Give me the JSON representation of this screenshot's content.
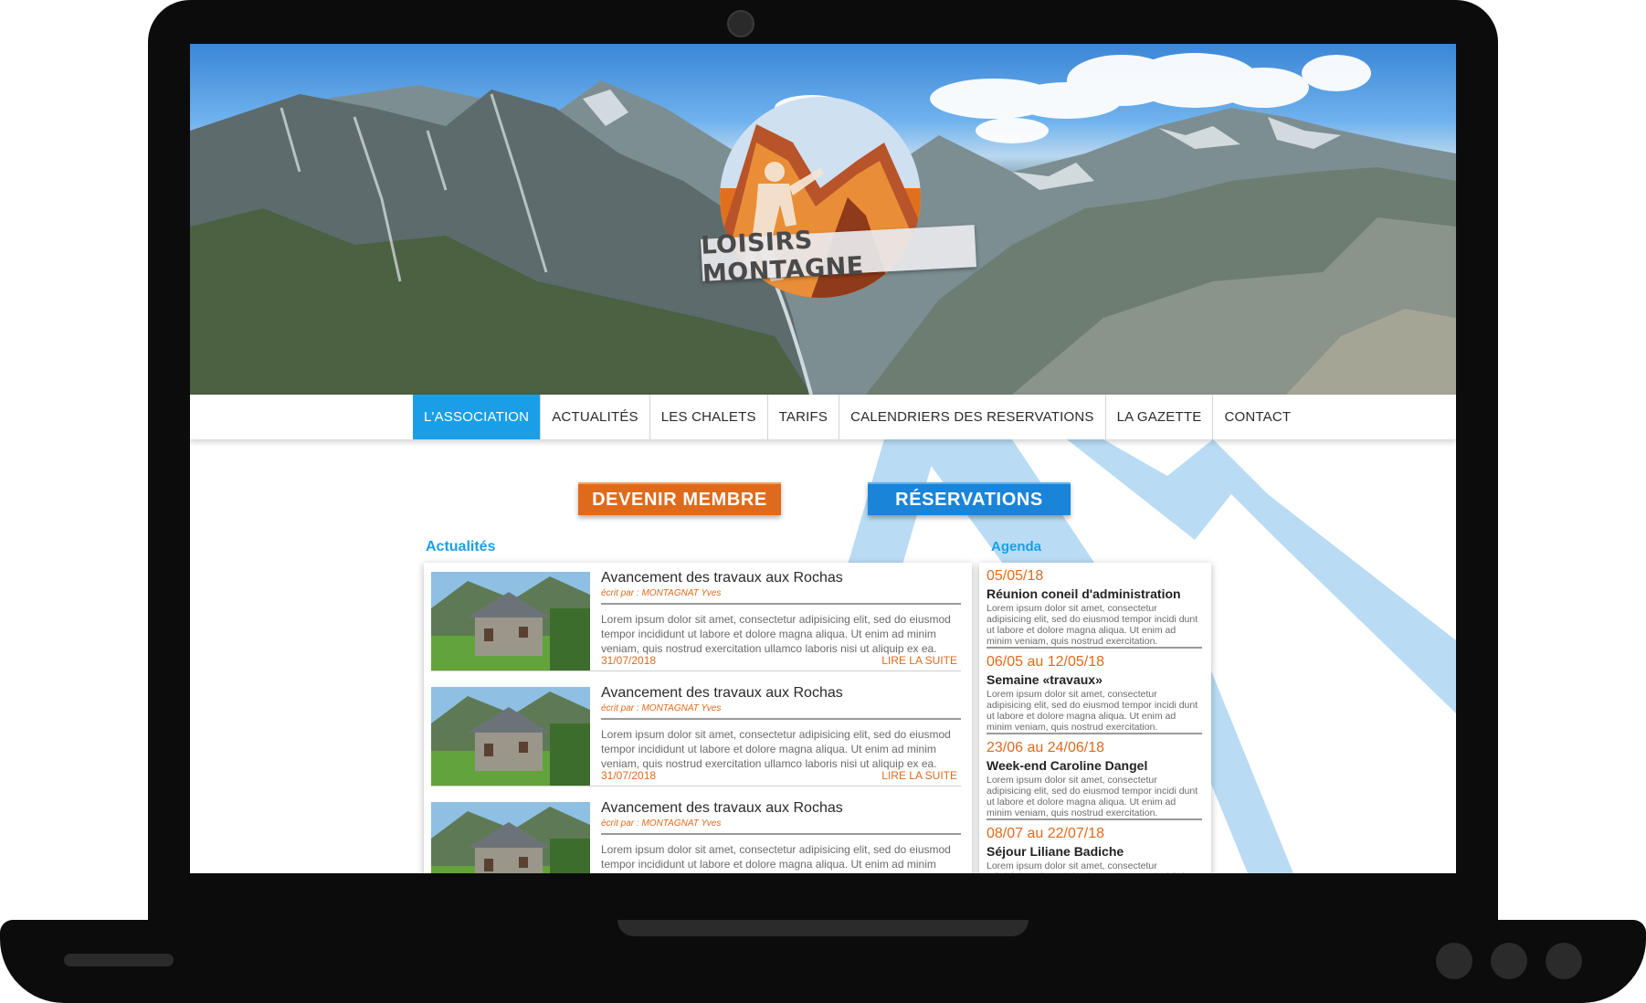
{
  "site": {
    "logo_text": "LOISIRS MONTAGNE",
    "brand_colors": {
      "orange": "#e06a1b",
      "blue": "#1a9fe6"
    }
  },
  "nav": {
    "items": [
      {
        "label": "L'ASSOCIATION",
        "active": true
      },
      {
        "label": "ACTUALITÉS",
        "active": false
      },
      {
        "label": "LES CHALETS",
        "active": false
      },
      {
        "label": "TARIFS",
        "active": false
      },
      {
        "label": "CALENDRIERS DES RESERVATIONS",
        "active": false
      },
      {
        "label": "LA GAZETTE",
        "active": false
      },
      {
        "label": "CONTACT",
        "active": false
      }
    ]
  },
  "cta": {
    "member": "DEVENIR MEMBRE",
    "reservations": "RÉSERVATIONS"
  },
  "news": {
    "title": "Actualités",
    "items": [
      {
        "title": "Avancement des travaux aux Rochas",
        "author": "écrit par : MONTAGNAT Yves",
        "body": "Lorem ipsum dolor sit amet, consectetur adipisicing elit, sed do eiusmod tempor incididunt ut labore et dolore magna aliqua. Ut enim ad minim veniam, quis nostrud exercitation ullamco laboris nisi ut aliquip ex ea.",
        "date": "31/07/2018",
        "more": "LIRE LA SUITE"
      },
      {
        "title": "Avancement des travaux aux Rochas",
        "author": "écrit par : MONTAGNAT Yves",
        "body": "Lorem ipsum dolor sit amet, consectetur adipisicing elit, sed do eiusmod tempor incididunt ut labore et dolore magna aliqua. Ut enim ad minim veniam, quis nostrud exercitation ullamco laboris nisi ut aliquip ex ea.",
        "date": "31/07/2018",
        "more": "LIRE LA SUITE"
      },
      {
        "title": "Avancement des travaux aux Rochas",
        "author": "écrit par : MONTAGNAT Yves",
        "body": "Lorem ipsum dolor sit amet, consectetur adipisicing elit, sed do eiusmod tempor incididunt ut labore et dolore magna aliqua. Ut enim ad minim",
        "date": "",
        "more": ""
      }
    ]
  },
  "agenda": {
    "title": "Agenda",
    "items": [
      {
        "date": "05/05/18",
        "title": "Réunion coneil d'administration",
        "body": "Lorem ipsum dolor sit amet, consectetur adipisicing elit, sed do eiusmod tempor incidi dunt ut labore et dolore magna aliqua. Ut enim ad minim veniam, quis nostrud exercitation."
      },
      {
        "date": "06/05 au 12/05/18",
        "title": "Semaine «travaux»",
        "body": "Lorem ipsum dolor sit amet, consectetur adipisicing elit, sed do eiusmod tempor incidi dunt ut labore et dolore magna aliqua. Ut enim ad minim veniam, quis nostrud exercitation."
      },
      {
        "date": "23/06 au 24/06/18",
        "title": "Week-end Caroline Dangel",
        "body": "Lorem ipsum dolor sit amet, consectetur adipisicing elit, sed do eiusmod tempor incidi dunt ut labore et dolore magna aliqua. Ut enim ad minim veniam, quis nostrud exercitation."
      },
      {
        "date": "08/07 au 22/07/18",
        "title": "Séjour Liliane Badiche",
        "body": "Lorem ipsum dolor sit amet, consectetur adipisicing elit, sed do eiusmod tempor incidi dunt ut labore et dolore magna aliqua."
      }
    ]
  }
}
